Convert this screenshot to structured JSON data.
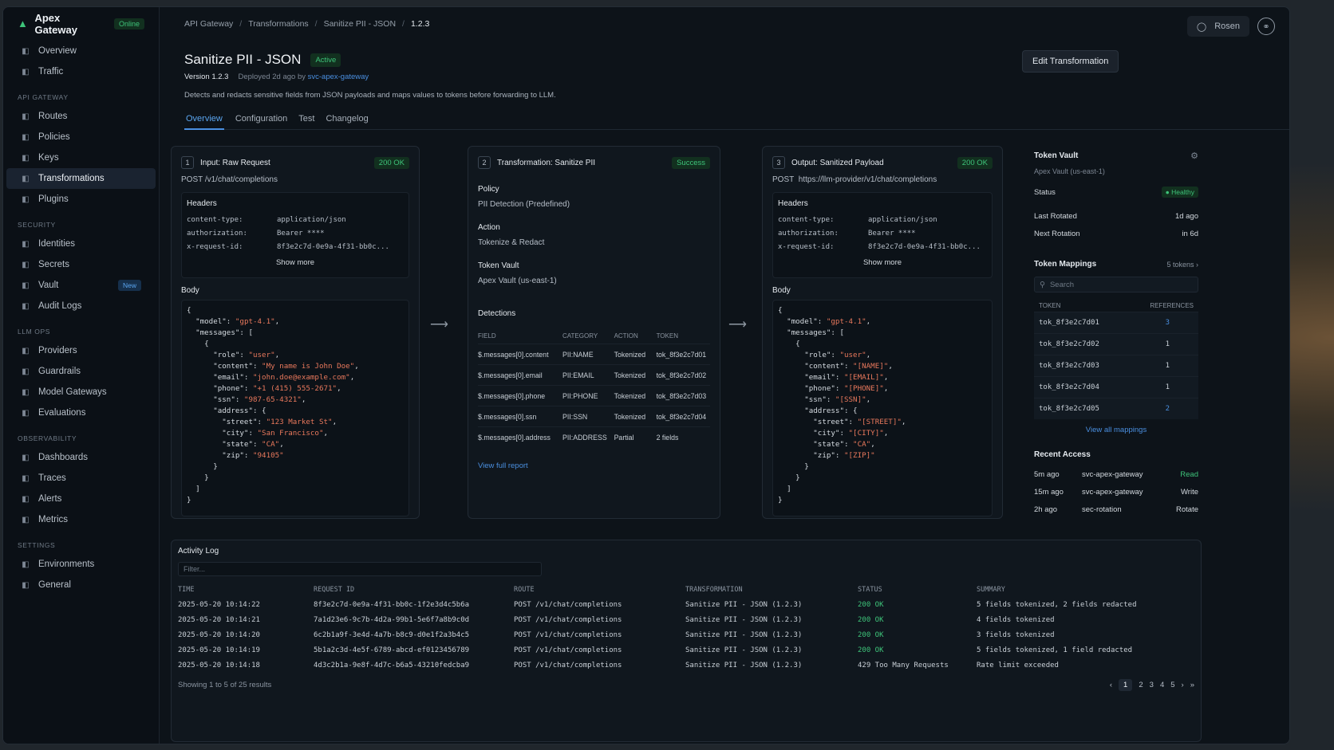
{
  "app": {
    "name": "Apex Gateway",
    "status": "Online"
  },
  "sidebar": {
    "top": [
      {
        "label": "Overview",
        "icon": "grid-icon"
      },
      {
        "label": "Traffic",
        "icon": "traffic-icon"
      }
    ],
    "sections": [
      {
        "title": "API GATEWAY",
        "items": [
          {
            "label": "Routes"
          },
          {
            "label": "Policies"
          },
          {
            "label": "Keys"
          },
          {
            "label": "Transformations",
            "active": true
          },
          {
            "label": "Plugins"
          }
        ]
      },
      {
        "title": "SECURITY",
        "items": [
          {
            "label": "Identities"
          },
          {
            "label": "Secrets"
          },
          {
            "label": "Vault",
            "badge": "New"
          },
          {
            "label": "Audit Logs"
          }
        ]
      },
      {
        "title": "LLM OPS",
        "items": [
          {
            "label": "Providers"
          },
          {
            "label": "Guardrails"
          },
          {
            "label": "Model Gateways"
          },
          {
            "label": "Evaluations"
          }
        ]
      },
      {
        "title": "OBSERVABILITY",
        "items": [
          {
            "label": "Dashboards"
          },
          {
            "label": "Traces"
          },
          {
            "label": "Alerts"
          },
          {
            "label": "Metrics"
          }
        ]
      },
      {
        "title": "SETTINGS",
        "items": [
          {
            "label": "Environments"
          },
          {
            "label": "General"
          }
        ]
      }
    ]
  },
  "breadcrumb": [
    "API Gateway",
    "Transformations",
    "Sanitize PII - JSON",
    "1.2.3"
  ],
  "topbar": {
    "user_label": "Rosen"
  },
  "header": {
    "title": "Sanitize PII - JSON",
    "status": "Active",
    "version": "Version 1.2.3",
    "deployed": "Deployed 2d ago by",
    "deployed_by": "svc-apex-gateway",
    "description": "Detects and redacts sensitive fields from JSON payloads and maps values to tokens before forwarding to LLM.",
    "edit_label": "Edit Transformation"
  },
  "tabs": [
    "Overview",
    "Configuration",
    "Test",
    "Changelog"
  ],
  "input": {
    "num": "1",
    "title": "Input: Raw Request",
    "status": "200 OK",
    "endpoint": "POST /v1/chat/completions",
    "headers_label": "Headers",
    "headers": [
      [
        "content-type:",
        "application/json"
      ],
      [
        "authorization:",
        "Bearer ****"
      ],
      [
        "x-request-id:",
        "8f3e2c7d-0e9a-4f31-bb0c..."
      ]
    ],
    "show_more": "Show more",
    "body_label": "Body"
  },
  "transform": {
    "num": "2",
    "title": "Transformation: Sanitize PII",
    "status": "Success",
    "policy_label": "Policy",
    "policy": "PII Detection (Predefined)",
    "action_label": "Action",
    "action": "Tokenize & Redact",
    "vault_label": "Token Vault",
    "vault": "Apex Vault (us-east-1)",
    "detections_label": "Detections",
    "det_cols": [
      "FIELD",
      "CATEGORY",
      "ACTION",
      "TOKEN"
    ],
    "detections": [
      [
        "$.messages[0].content",
        "PII:NAME",
        "Tokenized",
        "tok_8f3e2c7d01"
      ],
      [
        "$.messages[0].email",
        "PII:EMAIL",
        "Tokenized",
        "tok_8f3e2c7d02"
      ],
      [
        "$.messages[0].phone",
        "PII:PHONE",
        "Tokenized",
        "tok_8f3e2c7d03"
      ],
      [
        "$.messages[0].ssn",
        "PII:SSN",
        "Tokenized",
        "tok_8f3e2c7d04"
      ],
      [
        "$.messages[0].address",
        "PII:ADDRESS",
        "Partial",
        "2 fields"
      ]
    ],
    "report_link": "View full report"
  },
  "output": {
    "num": "3",
    "title": "Output: Sanitized Payload",
    "status": "200 OK",
    "endpoint_method": "POST",
    "endpoint_url": "https://llm-provider/v1/chat/completions",
    "headers_label": "Headers",
    "headers": [
      [
        "content-type:",
        "application/json"
      ],
      [
        "authorization:",
        "Bearer ****"
      ],
      [
        "x-request-id:",
        "8f3e2c7d-0e9a-4f31-bb0c..."
      ]
    ],
    "show_more": "Show more",
    "body_label": "Body"
  },
  "vault": {
    "title": "Token Vault",
    "subtitle": "Apex Vault (us-east-1)",
    "status_label": "Status",
    "status": "Healthy",
    "rotated_label": "Last Rotated",
    "rotated": "1d ago",
    "next_label": "Next Rotation",
    "next": "in 6d",
    "mappings_label": "Token Mappings",
    "mappings_count": "5 tokens",
    "search_placeholder": "Search",
    "cols": [
      "TOKEN",
      "REFERENCES"
    ],
    "tokens": [
      [
        "tok_8f3e2c7d01",
        "3"
      ],
      [
        "tok_8f3e2c7d02",
        "1"
      ],
      [
        "tok_8f3e2c7d03",
        "1"
      ],
      [
        "tok_8f3e2c7d04",
        "1"
      ],
      [
        "tok_8f3e2c7d05",
        "2"
      ]
    ],
    "view_all": "View all mappings",
    "recent_label": "Recent Access",
    "recent": [
      [
        "5m ago",
        "svc-apex-gateway",
        "Read"
      ],
      [
        "15m ago",
        "svc-apex-gateway",
        "Write"
      ],
      [
        "2h ago",
        "sec-rotation",
        "Rotate"
      ]
    ]
  },
  "activity": {
    "title": "Activity Log",
    "filter_placeholder": "Filter...",
    "cols": [
      "TIME",
      "REQUEST ID",
      "ROUTE",
      "TRANSFORMATION",
      "STATUS",
      "SUMMARY"
    ],
    "rows": [
      [
        "2025-05-20 10:14:22",
        "8f3e2c7d-0e9a-4f31-bb0c-1f2e3d4c5b6a",
        "POST /v1/chat/completions",
        "Sanitize PII - JSON (1.2.3)",
        "200 OK",
        "5 fields tokenized, 2 fields redacted"
      ],
      [
        "2025-05-20 10:14:21",
        "7a1d23e6-9c7b-4d2a-99b1-5e6f7a8b9c0d",
        "POST /v1/chat/completions",
        "Sanitize PII - JSON (1.2.3)",
        "200 OK",
        "4 fields tokenized"
      ],
      [
        "2025-05-20 10:14:20",
        "6c2b1a9f-3e4d-4a7b-b8c9-d0e1f2a3b4c5",
        "POST /v1/chat/completions",
        "Sanitize PII - JSON (1.2.3)",
        "200 OK",
        "3 fields tokenized"
      ],
      [
        "2025-05-20 10:14:19",
        "5b1a2c3d-4e5f-6789-abcd-ef0123456789",
        "POST /v1/chat/completions",
        "Sanitize PII - JSON (1.2.3)",
        "200 OK",
        "5 fields tokenized, 1 field redacted"
      ],
      [
        "2025-05-20 10:14:18",
        "4d3c2b1a-9e8f-4d7c-b6a5-43210fedcba9",
        "POST /v1/chat/completions",
        "Sanitize PII - JSON (1.2.3)",
        "429 Too Many Requests",
        "Rate limit exceeded"
      ]
    ],
    "footer": "Showing 1 to 5 of 25 results",
    "pages": [
      "1",
      "2",
      "3",
      "4",
      "5"
    ]
  },
  "colors": {
    "accent": "#4a8fe0",
    "success": "#3ec47a",
    "string": "#e8785c"
  }
}
